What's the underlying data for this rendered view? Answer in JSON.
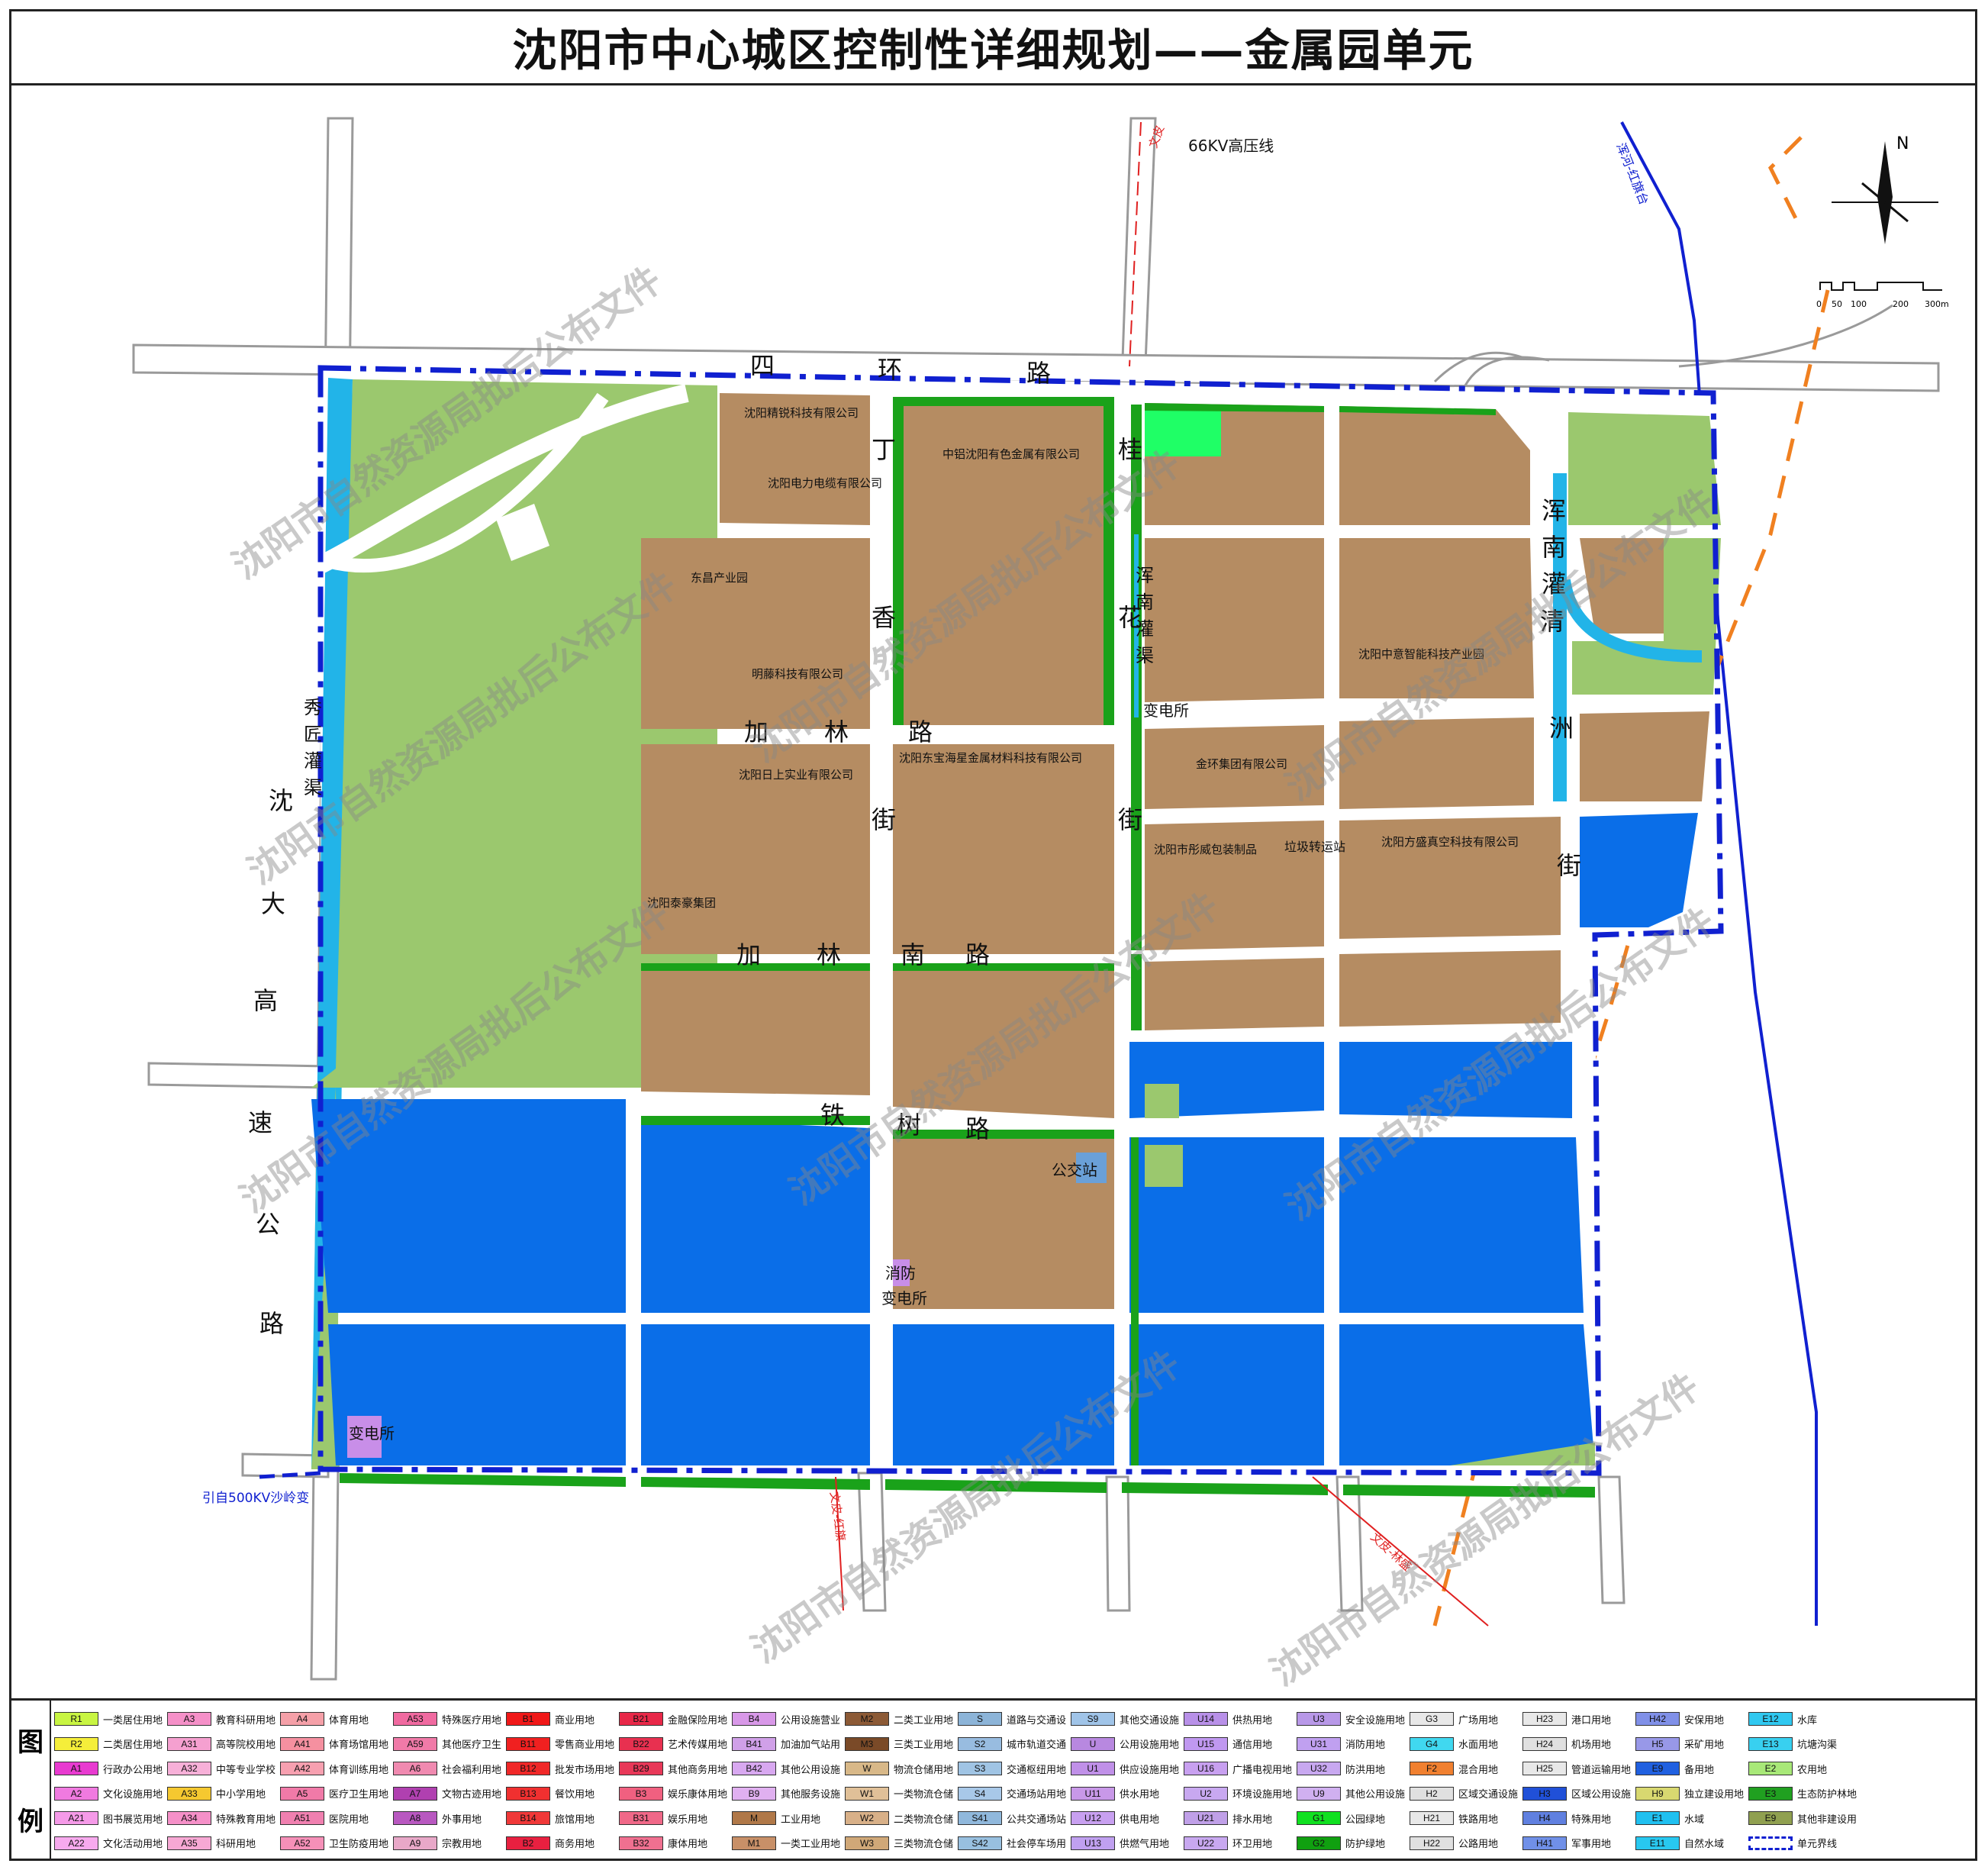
{
  "title": "沈阳市中心城区控制性详细规划——金属园单元",
  "colors": {
    "industrial": "#b58c62",
    "storage": "#0a6ee8",
    "park": "#9bc86e",
    "protective": "#1aa21a",
    "plaza": "#1fff66",
    "utility": "#c88ee8",
    "water": "#22b4e8",
    "boundary": "#1020d0"
  },
  "north": "N",
  "scale": {
    "ticks": [
      "0",
      "50",
      "100",
      "200",
      "300m"
    ]
  },
  "roads": {
    "r1": "四",
    "r2": "环",
    "r3": "路",
    "dinggui1": "丁",
    "dinggui2": "桂",
    "xiang": "香",
    "hua": "花",
    "jie1": "街",
    "jie2": "街",
    "jialin1": "加",
    "jialin2": "林",
    "jialin3": "路",
    "jln1": "加",
    "jln2": "林",
    "jln3": "南",
    "jln4": "路",
    "tieshu1": "铁",
    "tieshu2": "树",
    "tieshu3": "路",
    "hn1": "浑",
    "hn2": "南",
    "hn3": "灌",
    "hn4": "渠",
    "hne1": "浑",
    "hne2": "南",
    "hne3": "灌",
    "qz1": "清",
    "qz2": "洲",
    "qz3": "街",
    "xj1": "秀",
    "xj2": "匠",
    "xj3": "灌",
    "xj4": "渠",
    "sd1": "沈",
    "sd2": "大",
    "sd3": "高",
    "sd4": "速",
    "sd5": "公",
    "sd6": "路",
    "gaoya": "66KV高压线",
    "wenhong": "浑河-红旗台",
    "wen1": "文皮",
    "wen2": "文皮-红旗",
    "wen3": "文皮-林盛",
    "yinzi": "引自500KV沙岭变"
  },
  "companies": [
    "沈阳精锐科技有限公司",
    "沈阳电力电缆有限公司",
    "中铝沈阳有色金属有限公司",
    "东昌产业园",
    "明藤科技有限公司",
    "沈阳中意智能科技产业园",
    "沈阳日上实业有限公司",
    "沈阳东宝海星金属材料科技有限公司",
    "金环集团有限公司",
    "沈阳市彤威包装制品",
    "沈阳方盛真空科技有限公司",
    "沈阳泰豪集团"
  ],
  "facilities": {
    "substation1": "变电所",
    "garbage": "垃圾转运站",
    "bus": "公交站",
    "fire": "消防",
    "substation2": "变电所",
    "substation3": "变电所"
  },
  "watermark": "沈阳市自然资源局批后公布文件",
  "legend": {
    "head1": "图",
    "head2": "例",
    "items": [
      {
        "code": "R1",
        "name": "一类居住用地",
        "color": "#c8f542"
      },
      {
        "code": "R2",
        "name": "二类居住用地",
        "color": "#f5ee3a"
      },
      {
        "code": "A1",
        "name": "行政办公用地",
        "color": "#e83ad0"
      },
      {
        "code": "A2",
        "name": "文化设施用地",
        "color": "#f07ae0"
      },
      {
        "code": "A21",
        "name": "图书展览用地",
        "color": "#f59ae8"
      },
      {
        "code": "A22",
        "name": "文化活动用地",
        "color": "#f7aaee"
      },
      {
        "code": "A3",
        "name": "教育科研用地",
        "color": "#f590c8"
      },
      {
        "code": "A31",
        "name": "高等院校用地",
        "color": "#f5a0d0"
      },
      {
        "code": "A32",
        "name": "中等专业学校用地",
        "color": "#f7b0d8"
      },
      {
        "code": "A33",
        "name": "中小学用地",
        "color": "#f5c830"
      },
      {
        "code": "A34",
        "name": "特殊教育用地",
        "color": "#f590c8"
      },
      {
        "code": "A35",
        "name": "科研用地",
        "color": "#f7a8d4"
      },
      {
        "code": "A4",
        "name": "体育用地",
        "color": "#f5a0a8"
      },
      {
        "code": "A41",
        "name": "体育场馆用地",
        "color": "#f590a0"
      },
      {
        "code": "A42",
        "name": "体育训练用地",
        "color": "#f7a0b0"
      },
      {
        "code": "A5",
        "name": "医疗卫生用地",
        "color": "#f07aa8"
      },
      {
        "code": "A51",
        "name": "医院用地",
        "color": "#f080b0"
      },
      {
        "code": "A52",
        "name": "卫生防疫用地",
        "color": "#f590b8"
      },
      {
        "code": "A53",
        "name": "特殊医疗用地",
        "color": "#f06aa0"
      },
      {
        "code": "A59",
        "name": "其他医疗卫生用地",
        "color": "#f07aa8"
      },
      {
        "code": "A6",
        "name": "社会福利用地",
        "color": "#f08ab0"
      },
      {
        "code": "A7",
        "name": "文物古迹用地",
        "color": "#b040b0"
      },
      {
        "code": "A8",
        "name": "外事用地",
        "color": "#b858c0"
      },
      {
        "code": "A9",
        "name": "宗教用地",
        "color": "#e8a8c8"
      },
      {
        "code": "B1",
        "name": "商业用地",
        "color": "#f01818"
      },
      {
        "code": "B11",
        "name": "零售商业用地",
        "color": "#f02020"
      },
      {
        "code": "B12",
        "name": "批发市场用地",
        "color": "#f02828"
      },
      {
        "code": "B13",
        "name": "餐饮用地",
        "color": "#f03030"
      },
      {
        "code": "B14",
        "name": "旅馆用地",
        "color": "#f03838"
      },
      {
        "code": "B2",
        "name": "商务用地",
        "color": "#e82040"
      },
      {
        "code": "B21",
        "name": "金融保险用地",
        "color": "#e82848"
      },
      {
        "code": "B22",
        "name": "艺术传媒用地",
        "color": "#e83050"
      },
      {
        "code": "B29",
        "name": "其他商务用地",
        "color": "#e83858"
      },
      {
        "code": "B3",
        "name": "娱乐康体用地",
        "color": "#f06080"
      },
      {
        "code": "B31",
        "name": "娱乐用地",
        "color": "#f06888"
      },
      {
        "code": "B32",
        "name": "康体用地",
        "color": "#f07090"
      },
      {
        "code": "B4",
        "name": "公用设施营业网点用地",
        "color": "#d898e8"
      },
      {
        "code": "B41",
        "name": "加油加气站用地",
        "color": "#d0a0e8"
      },
      {
        "code": "B42",
        "name": "其他公用设施营业网点用地",
        "color": "#d8a8f0"
      },
      {
        "code": "B9",
        "name": "其他服务设施用地",
        "color": "#e0b0f0"
      },
      {
        "code": "M",
        "name": "工业用地",
        "color": "#b07848"
      },
      {
        "code": "M1",
        "name": "一类工业用地",
        "color": "#c89068"
      },
      {
        "code": "M2",
        "name": "二类工业用地",
        "color": "#8c5a36"
      },
      {
        "code": "M3",
        "name": "三类工业用地",
        "color": "#7a4a28"
      },
      {
        "code": "W",
        "name": "物流仓储用地",
        "color": "#d8b888"
      },
      {
        "code": "W1",
        "name": "一类物流仓储用地",
        "color": "#e0c098"
      },
      {
        "code": "W2",
        "name": "二类物流仓储用地",
        "color": "#d8b088"
      },
      {
        "code": "W3",
        "name": "三类物流仓储用地",
        "color": "#d0a878"
      },
      {
        "code": "S",
        "name": "道路与交通设施用地",
        "color": "#8cb4d8"
      },
      {
        "code": "S2",
        "name": "城市轨道交通用地",
        "color": "#98bce0"
      },
      {
        "code": "S3",
        "name": "交通枢纽用地",
        "color": "#a0c4e4"
      },
      {
        "code": "S4",
        "name": "交通场站用地",
        "color": "#a8c8e8"
      },
      {
        "code": "S41",
        "name": "公共交通场站用地",
        "color": "#90b8dc"
      },
      {
        "code": "S42",
        "name": "社会停车场用地",
        "color": "#98c0e0"
      },
      {
        "code": "S9",
        "name": "其他交通设施用地",
        "color": "#a0c4e8"
      },
      {
        "code": "U",
        "name": "公用设施用地",
        "color": "#b888e0"
      },
      {
        "code": "U1",
        "name": "供应设施用地",
        "color": "#c090e8"
      },
      {
        "code": "U11",
        "name": "供水用地",
        "color": "#c898e8"
      },
      {
        "code": "U12",
        "name": "供电用地",
        "color": "#c8a0f0"
      },
      {
        "code": "U13",
        "name": "供燃气用地",
        "color": "#c0a0f0"
      },
      {
        "code": "U14",
        "name": "供热用地",
        "color": "#b890e8"
      },
      {
        "code": "U15",
        "name": "通信用地",
        "color": "#c098f0"
      },
      {
        "code": "U16",
        "name": "广播电视用地",
        "color": "#c8a0f0"
      },
      {
        "code": "U2",
        "name": "环境设施用地",
        "color": "#c8a8f0"
      },
      {
        "code": "U21",
        "name": "排水用地",
        "color": "#c0a0e8"
      },
      {
        "code": "U22",
        "name": "环卫用地",
        "color": "#c8a8f0"
      },
      {
        "code": "U3",
        "name": "安全设施用地",
        "color": "#b898e8"
      },
      {
        "code": "U31",
        "name": "消防用地",
        "color": "#c0a0f0"
      },
      {
        "code": "U32",
        "name": "防洪用地",
        "color": "#c8a8f0"
      },
      {
        "code": "U9",
        "name": "其他公用设施用地",
        "color": "#d0b0f0"
      },
      {
        "code": "G1",
        "name": "公园绿地",
        "color": "#10e020"
      },
      {
        "code": "G2",
        "name": "防护绿地",
        "color": "#10a010"
      },
      {
        "code": "G3",
        "name": "广场用地",
        "color": "#e8e8e8"
      },
      {
        "code": "G4",
        "name": "水面用地",
        "color": "#40d8f0"
      },
      {
        "code": "F2",
        "name": "混合用地",
        "color": "#f08030"
      },
      {
        "code": "H2",
        "name": "区域交通设施用地",
        "color": "#e0e0e0"
      },
      {
        "code": "H21",
        "name": "铁路用地",
        "color": "#e8e8e8"
      },
      {
        "code": "H22",
        "name": "公路用地",
        "color": "#e0e0e0"
      },
      {
        "code": "H23",
        "name": "港口用地",
        "color": "#e8e8e8"
      },
      {
        "code": "H24",
        "name": "机场用地",
        "color": "#e0e0e0"
      },
      {
        "code": "H25",
        "name": "管道运输用地",
        "color": "#e8e8e8"
      },
      {
        "code": "H3",
        "name": "区域公用设施用地",
        "color": "#2050d8"
      },
      {
        "code": "H4",
        "name": "特殊用地",
        "color": "#6080e0"
      },
      {
        "code": "H41",
        "name": "军事用地",
        "color": "#7090e8"
      },
      {
        "code": "H42",
        "name": "安保用地",
        "color": "#8090e8"
      },
      {
        "code": "H5",
        "name": "采矿用地",
        "color": "#9898e8"
      },
      {
        "code": "E9",
        "name": "备用地",
        "color": "#2060e0"
      },
      {
        "code": "H9",
        "name": "独立建设用地",
        "color": "#d8d870"
      },
      {
        "code": "E1",
        "name": "水域",
        "color": "#20c0f0"
      },
      {
        "code": "E11",
        "name": "自然水域",
        "color": "#28c8f0"
      },
      {
        "code": "E12",
        "name": "水库",
        "color": "#30c8f0"
      },
      {
        "code": "E13",
        "name": "坑塘沟渠",
        "color": "#38d0f0"
      },
      {
        "code": "E2",
        "name": "农用地",
        "color": "#a8e878"
      },
      {
        "code": "E3",
        "name": "生态防护林地",
        "color": "#20a020"
      },
      {
        "code": "E9",
        "name": "其他非建设用地",
        "color": "#90a050"
      },
      {
        "code": "",
        "name": "单元界线",
        "color": "#ffffff"
      }
    ]
  }
}
